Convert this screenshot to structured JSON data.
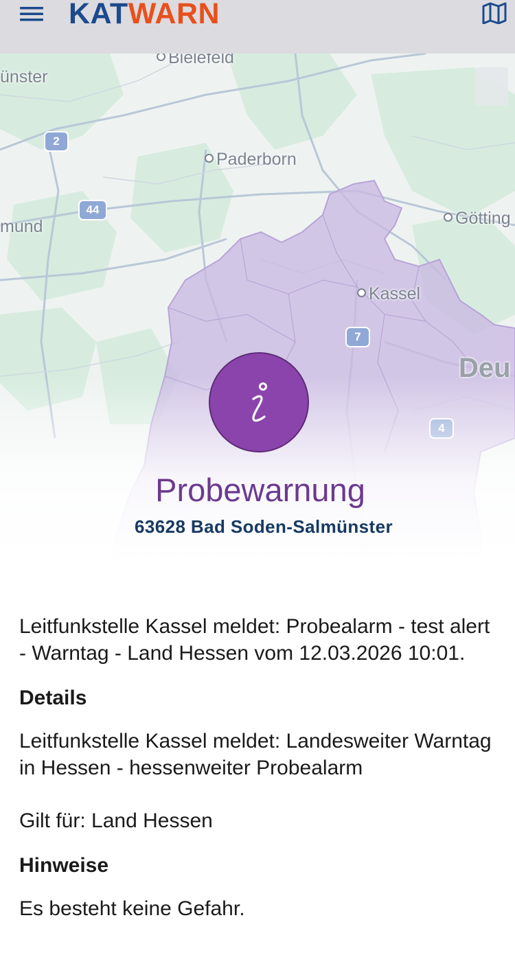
{
  "app": {
    "title_kat": "KAT",
    "title_warn": "WARN",
    "menu_icon": "hamburger-menu-icon",
    "map_icon": "map-icon",
    "brand_color_primary": "#1c4a8c",
    "brand_color_accent": "#e8501c"
  },
  "map": {
    "labels": {
      "bielefeld": "Bielefeld",
      "muenster": "ünster",
      "paderborn": "Paderborn",
      "dortmund": "mund",
      "goettingen": "Götting",
      "kassel": "Kassel",
      "deutschland": "Deu"
    },
    "roads": {
      "a2": "2",
      "a44": "44",
      "a7": "7",
      "a4": "4"
    },
    "area_color": "#c8b6e0"
  },
  "warning": {
    "icon": "info-icon",
    "icon_color": "#8c44ad",
    "title": "Probewarnung",
    "location": "63628 Bad Soden-Salmünster"
  },
  "body": {
    "summary": "Leitfunkstelle Kassel meldet: Probealarm - test alert - Warntag - Land Hessen vom 12.03.2026 10:01.",
    "details_heading": "Details",
    "details_text": "Leitfunkstelle Kassel meldet: Landesweiter Warntag in Hessen - hessenweiter Probealarm",
    "scope": "Gilt für: Land Hessen",
    "hints_heading": "Hinweise",
    "hints_text": "Es besteht keine Gefahr."
  }
}
